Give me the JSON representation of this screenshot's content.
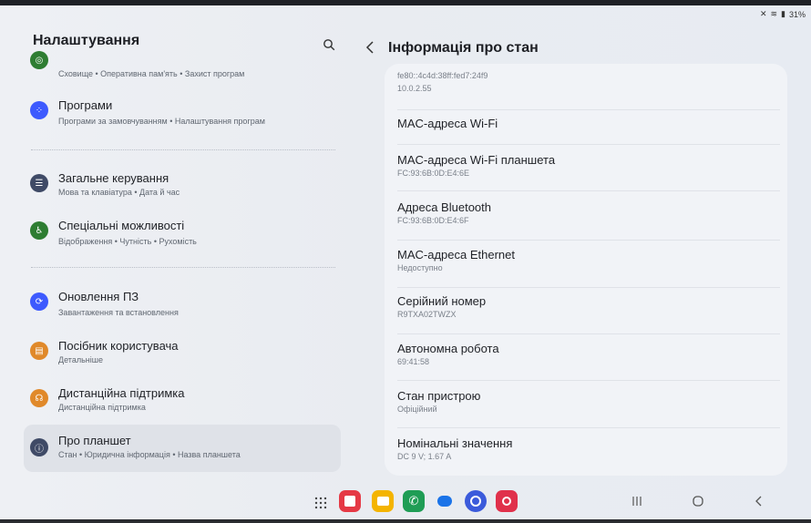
{
  "status": {
    "battery": "31%"
  },
  "left": {
    "title": "Налаштування",
    "items": [
      {
        "title": "",
        "sub": "Сховище  •  Оперативна пам'ять  •  Захист програм",
        "color": "#2e7d32",
        "icon": "device-care-icon"
      },
      {
        "title": "Програми",
        "sub": "Програми за замовчуванням  •  Налаштування програм",
        "color": "#3d5afe",
        "icon": "apps-icon"
      },
      {
        "title": "Загальне керування",
        "sub": "Мова та клавіатура  •  Дата й час",
        "color": "#3f4a66",
        "icon": "general-management-icon"
      },
      {
        "title": "Спеціальні можливості",
        "sub": "Відображення  •  Чутність  •  Рухомість",
        "color": "#2e7d32",
        "icon": "accessibility-icon"
      },
      {
        "title": "Оновлення ПЗ",
        "sub": "Завантаження та встановлення",
        "color": "#3d5afe",
        "icon": "software-update-icon"
      },
      {
        "title": "Посібник користувача",
        "sub": "Детальніше",
        "color": "#e0892a",
        "icon": "user-manual-icon"
      },
      {
        "title": "Дистанційна підтримка",
        "sub": "Дистанційна підтримка",
        "color": "#e0892a",
        "icon": "remote-support-icon"
      },
      {
        "title": "Про планшет",
        "sub": "Стан  •  Юридична інформація  •  Назва планшета",
        "color": "#3f4a66",
        "icon": "about-tablet-icon"
      }
    ]
  },
  "right": {
    "title": "Інформація про стан",
    "ip_line1": "fe80::4c4d:38ff:fed7:24f9",
    "ip_line2": "10.0.2.55",
    "rows": [
      {
        "title": "MAC-адреса Wi-Fi",
        "value": ""
      },
      {
        "title": "MAC-адреса Wi-Fi планшета",
        "value": "FC:93:6B:0D:E4:6E"
      },
      {
        "title": "Адреса Bluetooth",
        "value": "FC:93:6B:0D:E4:6F"
      },
      {
        "title": "MAC-адреса Ethernet",
        "value": "Недоступно"
      },
      {
        "title": "Серійний номер",
        "value": "R9TXA02TWZX"
      },
      {
        "title": "Автономна робота",
        "value": "69:41:58"
      },
      {
        "title": "Стан пристрою",
        "value": "Офіційний"
      },
      {
        "title": "Номінальні значення",
        "value": "DC 9 V; 1.67 A"
      }
    ]
  },
  "dock": {
    "apps": [
      {
        "name": "notes-app-icon",
        "color": "#e53945"
      },
      {
        "name": "files-app-icon",
        "color": "#f4b400"
      },
      {
        "name": "phone-app-icon",
        "color": "#1f9d55"
      },
      {
        "name": "messages-app-icon",
        "color": "#1a73e8"
      },
      {
        "name": "internet-app-icon",
        "color": "#3b5bdb"
      },
      {
        "name": "screen-recorder-app-icon",
        "color": "#e0314b"
      }
    ]
  }
}
